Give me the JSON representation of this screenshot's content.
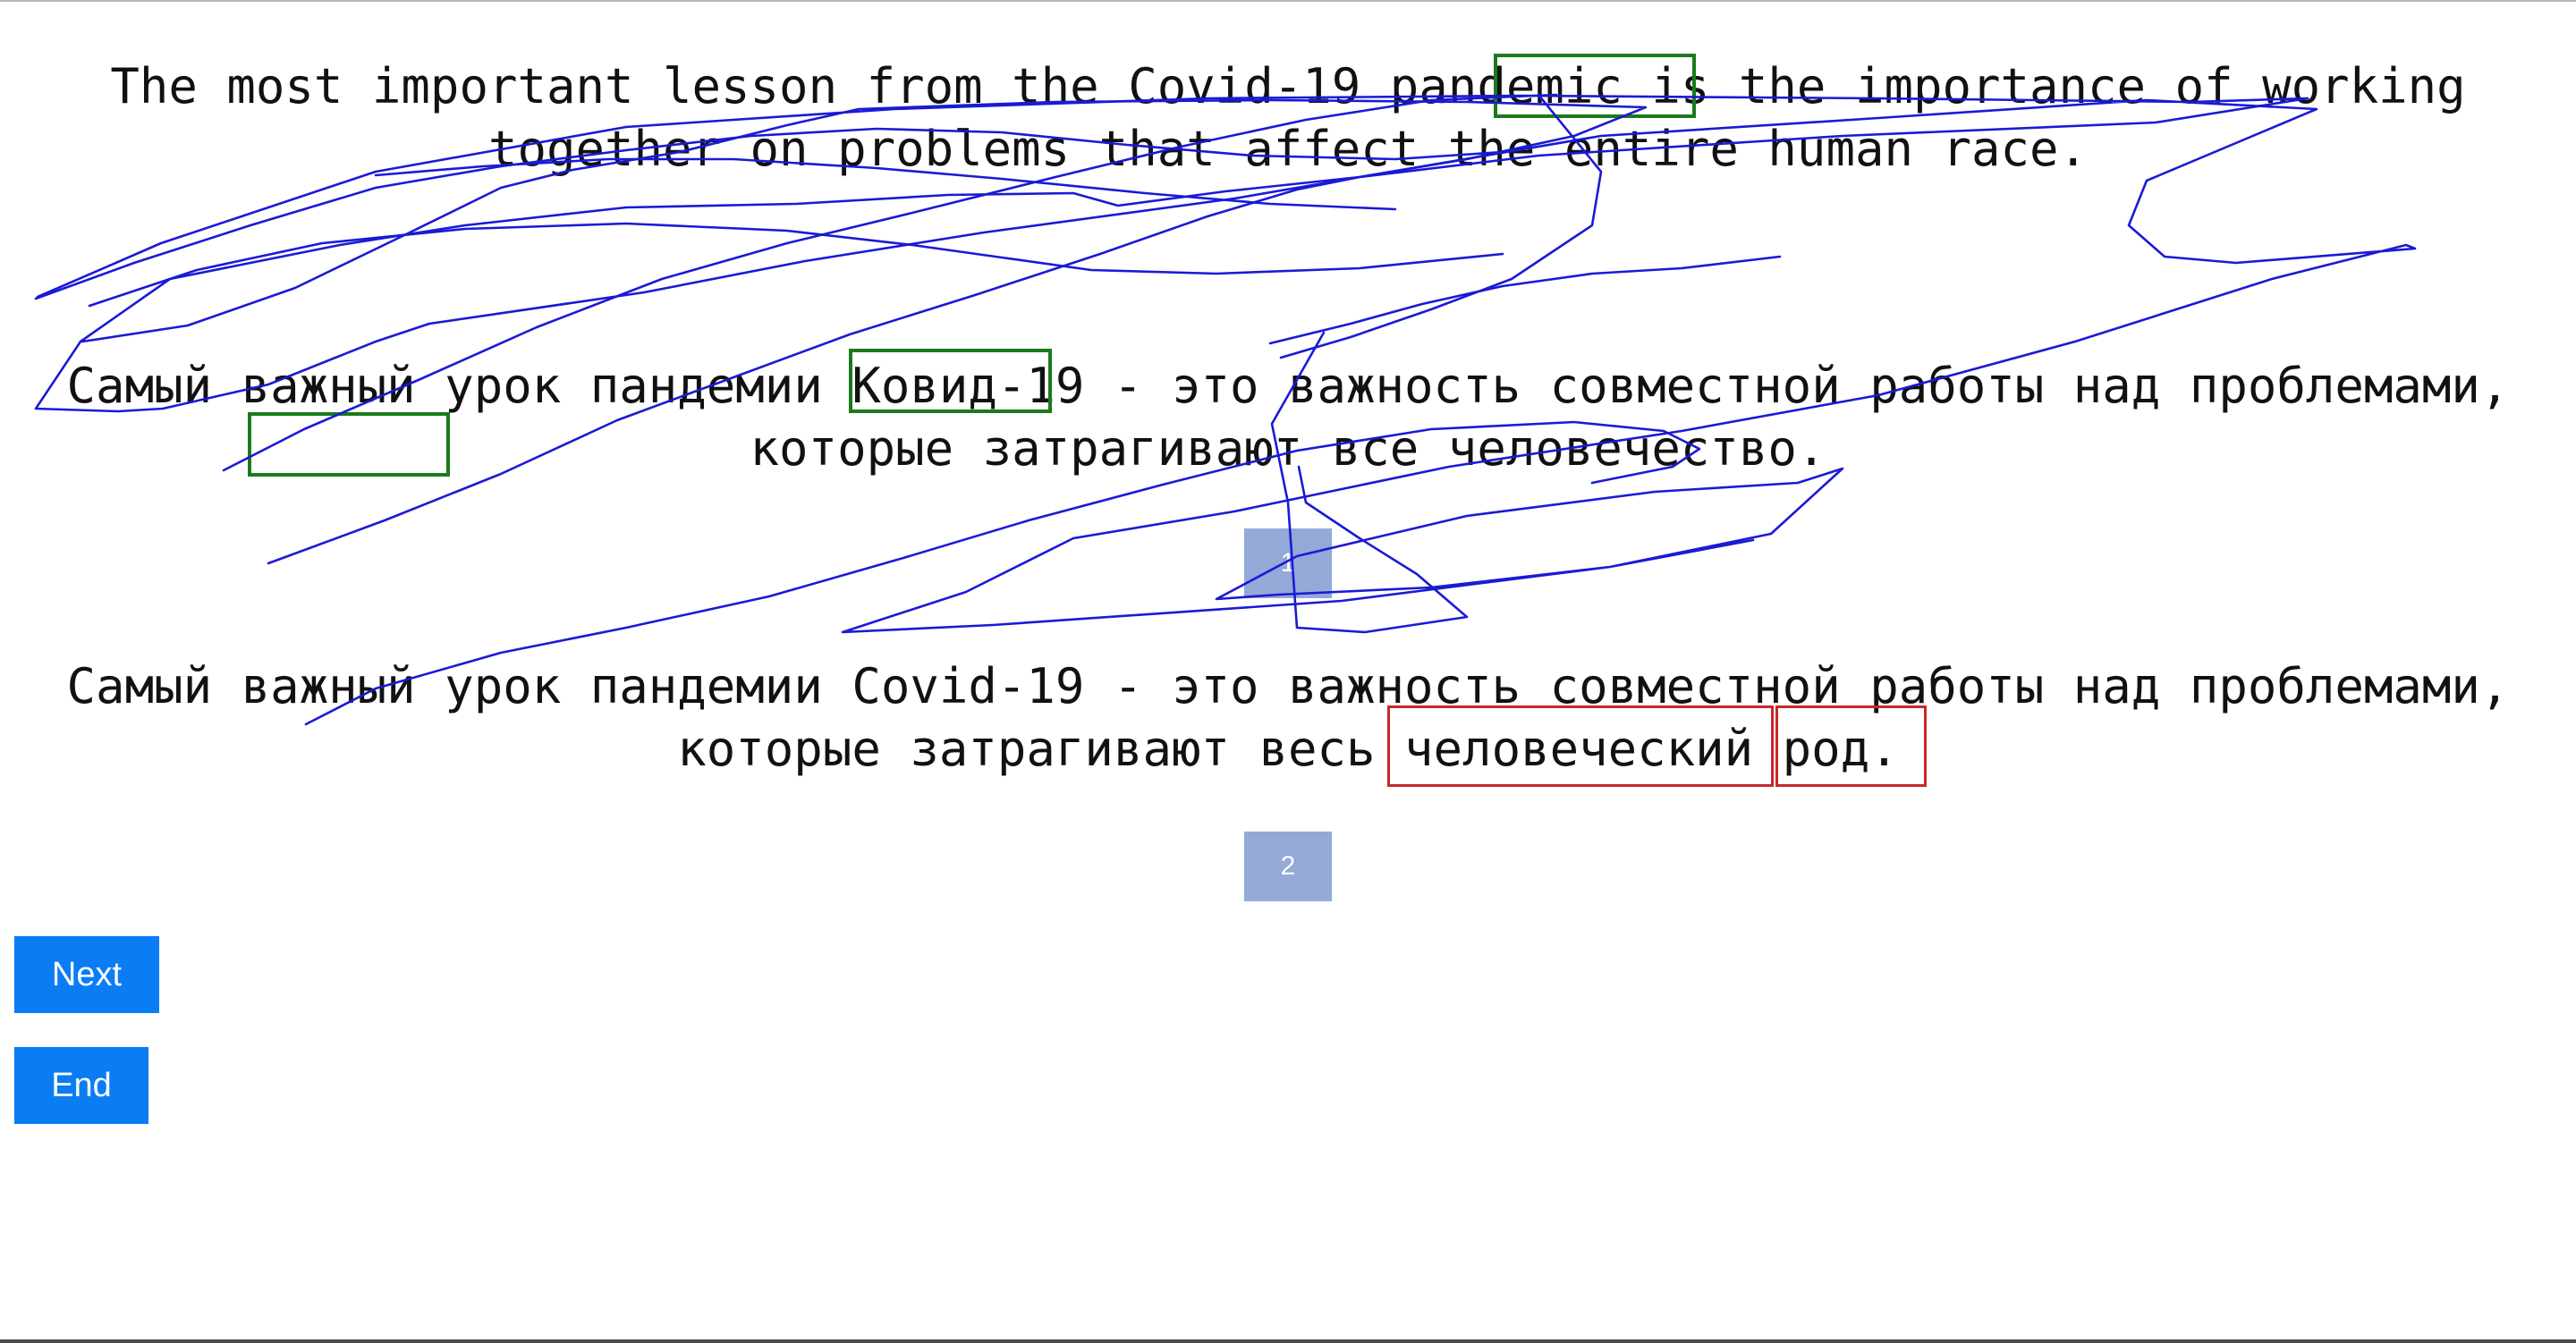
{
  "sentences": {
    "source": "The most important lesson from the Covid-19 pandemic is the importance of working\ntogether on problems that affect the entire human race.",
    "translation_1": "Самый важный урок пандемии Ковид-19 - это важность совместной работы над проблемами,\nкоторые затрагивают все человечество.",
    "translation_2": "Самый важный урок пандемии Covid-19 - это важность совместной работы над проблемами,\nкоторые затрагивают весь человеческий род."
  },
  "badges": {
    "translation_1": "1",
    "translation_2": "2"
  },
  "buttons": {
    "next_label": "Next",
    "end_label": "End"
  },
  "colors": {
    "match_box": "#1b7a1b",
    "mismatch_box": "#c62828",
    "ink": "#1a1ad6",
    "button": "#0a7df5",
    "badge": "#7894ce"
  }
}
